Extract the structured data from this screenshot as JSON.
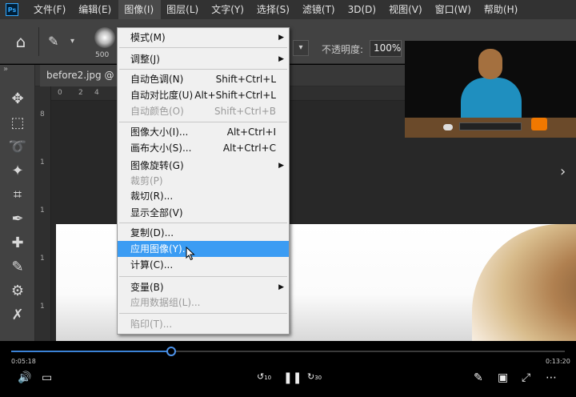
{
  "menubar": {
    "logo": "Ps",
    "items": [
      "文件(F)",
      "编辑(E)",
      "图像(I)",
      "图层(L)",
      "文字(Y)",
      "选择(S)",
      "滤镜(T)",
      "3D(D)",
      "视图(V)",
      "窗口(W)",
      "帮助(H)"
    ],
    "active_index": 2
  },
  "options": {
    "brush_size": "500",
    "opacity_label": "不透明度:",
    "opacity_value": "100%"
  },
  "document": {
    "tab_title": "before2.jpg @",
    "ruler_top": [
      "0",
      "2",
      "4"
    ],
    "ruler_left": [
      "8",
      "1",
      "1",
      "1",
      "1"
    ]
  },
  "image_menu": {
    "items": [
      {
        "label": "模式(M)",
        "shortcut": "",
        "submenu": true,
        "disabled": false
      },
      {
        "label": "调整(J)",
        "shortcut": "",
        "submenu": true,
        "disabled": false
      },
      {
        "label": "自动色调(N)",
        "shortcut": "Shift+Ctrl+L",
        "submenu": false,
        "disabled": false
      },
      {
        "label": "自动对比度(U)",
        "shortcut": "Alt+Shift+Ctrl+L",
        "submenu": false,
        "disabled": false
      },
      {
        "label": "自动颜色(O)",
        "shortcut": "Shift+Ctrl+B",
        "submenu": false,
        "disabled": true
      },
      {
        "label": "图像大小(I)...",
        "shortcut": "Alt+Ctrl+I",
        "submenu": false,
        "disabled": false
      },
      {
        "label": "画布大小(S)...",
        "shortcut": "Alt+Ctrl+C",
        "submenu": false,
        "disabled": false
      },
      {
        "label": "图像旋转(G)",
        "shortcut": "",
        "submenu": true,
        "disabled": false
      },
      {
        "label": "裁剪(P)",
        "shortcut": "",
        "submenu": false,
        "disabled": true
      },
      {
        "label": "裁切(R)...",
        "shortcut": "",
        "submenu": false,
        "disabled": false
      },
      {
        "label": "显示全部(V)",
        "shortcut": "",
        "submenu": false,
        "disabled": false
      },
      {
        "label": "复制(D)...",
        "shortcut": "",
        "submenu": false,
        "disabled": false
      },
      {
        "label": "应用图像(Y)...",
        "shortcut": "",
        "submenu": false,
        "disabled": false,
        "highlighted": true
      },
      {
        "label": "计算(C)...",
        "shortcut": "",
        "submenu": false,
        "disabled": false
      },
      {
        "label": "变量(B)",
        "shortcut": "",
        "submenu": true,
        "disabled": false
      },
      {
        "label": "应用数据组(L)...",
        "shortcut": "",
        "submenu": false,
        "disabled": true
      },
      {
        "label": "陷印(T)...",
        "shortcut": "",
        "submenu": false,
        "disabled": true
      }
    ]
  },
  "player": {
    "current_time": "0:05:18",
    "total_time": "0:13:20",
    "progress": 0.29,
    "rewind_label": "10",
    "forward_label": "30"
  },
  "colors": {
    "accent": "#3b9cf3",
    "progress": "#3b82d6",
    "menubar": "#323232"
  }
}
